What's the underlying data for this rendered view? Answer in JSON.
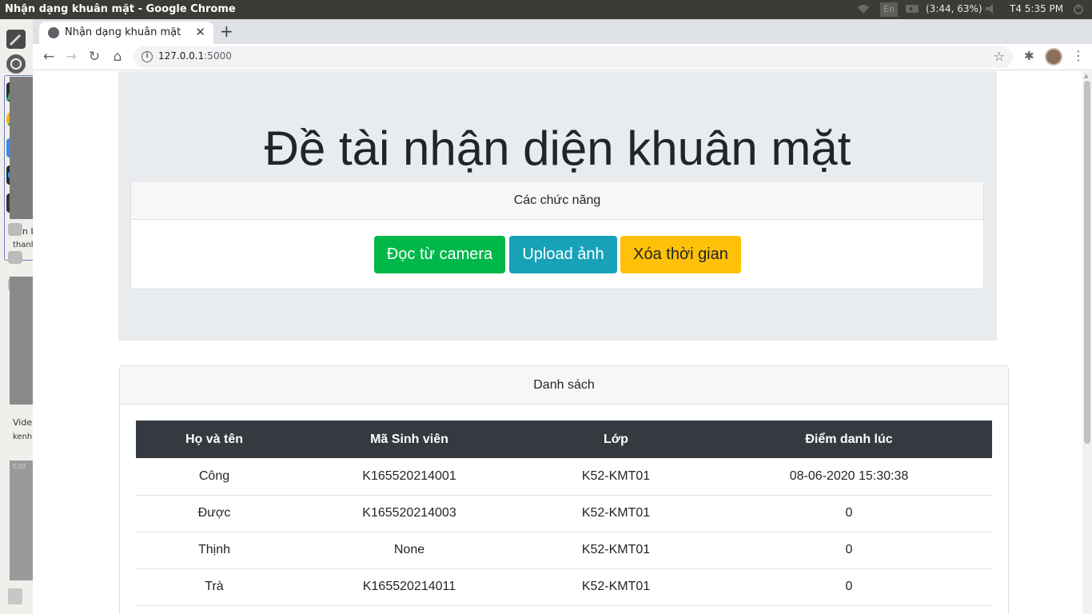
{
  "system": {
    "window_title": "Nhận dạng khuân mặt - Google Chrome",
    "keyboard": "En",
    "battery": "(3:44, 63%)",
    "clock": "T4  5:35 PM"
  },
  "launcher": {
    "snippets": [
      "n b",
      "thanh",
      "Vide",
      "kenh",
      "cor"
    ]
  },
  "browser": {
    "tab_title": "Nhận dạng khuân mặt",
    "url_host": "127.0.0.1",
    "url_port": ":5000"
  },
  "page": {
    "heading": "Đề tài nhận diện khuân mặt",
    "functions": {
      "header": "Các chức năng",
      "buttons": [
        "Đọc từ camera",
        "Upload ảnh",
        "Xóa thời gian"
      ]
    },
    "list": {
      "header": "Danh sách",
      "columns": [
        "Họ và tên",
        "Mã Sinh viên",
        "Lớp",
        "Điểm danh lúc"
      ],
      "rows": [
        [
          "Công",
          "K165520214001",
          "K52-KMT01",
          "08-06-2020 15:30:38"
        ],
        [
          "Được",
          "K165520214003",
          "K52-KMT01",
          "0"
        ],
        [
          "Thịnh",
          "None",
          "K52-KMT01",
          "0"
        ],
        [
          "Trà",
          "K165520214011",
          "K52-KMT01",
          "0"
        ]
      ]
    }
  },
  "colors": {
    "btn_camera": "#00b74a",
    "btn_upload": "#17a2b8",
    "btn_clear": "#ffc107",
    "table_head": "#343a40"
  }
}
